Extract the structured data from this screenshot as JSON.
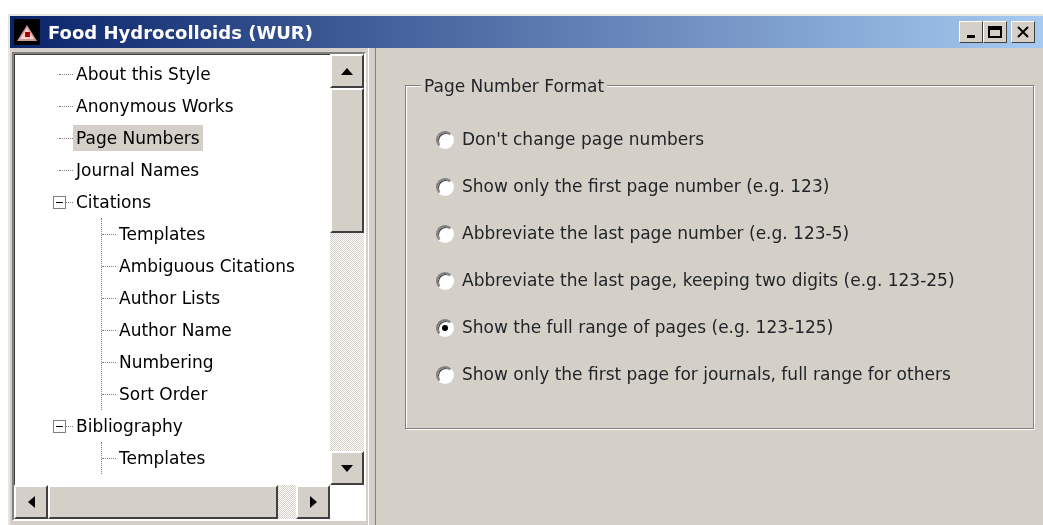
{
  "window": {
    "title": "Food Hydrocolloids (WUR)"
  },
  "tree": [
    {
      "label": "About this Style",
      "selected": false
    },
    {
      "label": "Anonymous Works",
      "selected": false
    },
    {
      "label": "Page Numbers",
      "selected": true
    },
    {
      "label": "Journal Names",
      "selected": false
    },
    {
      "label": "Citations",
      "selected": false,
      "expanded": true,
      "children": [
        {
          "label": "Templates",
          "selected": false
        },
        {
          "label": "Ambiguous Citations",
          "selected": false
        },
        {
          "label": "Author Lists",
          "selected": false
        },
        {
          "label": "Author Name",
          "selected": false
        },
        {
          "label": "Numbering",
          "selected": false
        },
        {
          "label": "Sort Order",
          "selected": false
        }
      ]
    },
    {
      "label": "Bibliography",
      "selected": false,
      "expanded": true,
      "children": [
        {
          "label": "Templates",
          "selected": false
        }
      ]
    }
  ],
  "group": {
    "title": "Page Number Format",
    "options": [
      {
        "label": "Don't change page numbers",
        "selected": false
      },
      {
        "label": "Show only the first page number (e.g. 123)",
        "selected": false
      },
      {
        "label": "Abbreviate the last page number (e.g. 123-5)",
        "selected": false
      },
      {
        "label": "Abbreviate the last page, keeping two digits (e.g. 123-25)",
        "selected": false
      },
      {
        "label": "Show the full range of pages (e.g. 123-125)",
        "selected": true
      },
      {
        "label": "Show only the first page for journals, full range for others",
        "selected": false
      }
    ]
  }
}
